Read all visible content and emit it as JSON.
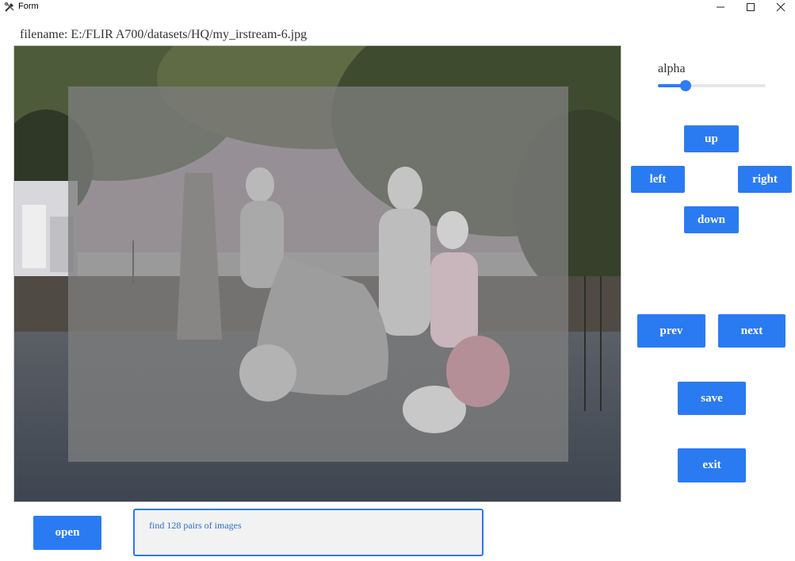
{
  "window": {
    "title": "Form",
    "minimize_icon": "minimize-icon",
    "maximize_icon": "maximize-icon",
    "close_icon": "close-icon",
    "app_icon": "tools-icon"
  },
  "filename": {
    "text": "filename: E:/FLIR A700/datasets/HQ/my_irstream-6.jpg"
  },
  "alpha": {
    "label": "alpha",
    "value_fraction": 0.26,
    "accent": "#2e7bf6"
  },
  "controls": {
    "up": "up",
    "left": "left",
    "right": "right",
    "down": "down",
    "prev": "prev",
    "next": "next",
    "save": "save",
    "exit": "exit",
    "open": "open"
  },
  "status": {
    "text": "find 128 pairs of images"
  },
  "colors": {
    "button": "#2a7bf2",
    "button_text": "#ffffff",
    "status_border": "#2a7bf2",
    "status_text": "#2a6fd6"
  }
}
